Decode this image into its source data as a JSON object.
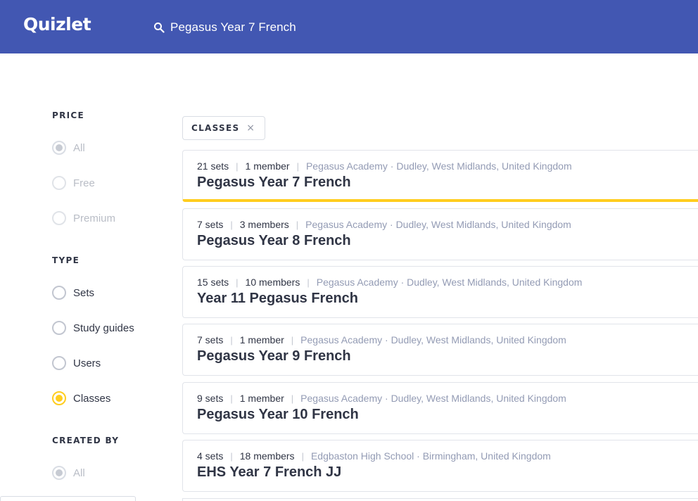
{
  "header": {
    "logo": "Quizlet",
    "search_icon": "search-icon",
    "search_query": "Pegasus Year 7 French"
  },
  "colors": {
    "header_bg": "#4257b2",
    "accent_yellow": "#ffcd1f",
    "text": "#303545",
    "muted": "#939bb4"
  },
  "filters": {
    "price": {
      "title": "PRICE",
      "options": [
        "All",
        "Free",
        "Premium"
      ],
      "selected": "All"
    },
    "type": {
      "title": "TYPE",
      "options": [
        "Sets",
        "Study guides",
        "Users",
        "Classes"
      ],
      "selected": "Classes"
    },
    "created_by": {
      "title": "CREATED BY",
      "options": [
        "All"
      ],
      "selected": "All"
    }
  },
  "active_filter_chip": {
    "label": "CLASSES",
    "close_icon": "close-icon",
    "close_glyph": "×"
  },
  "results": [
    {
      "sets": "21 sets",
      "members": "1 member",
      "school": "Pegasus Academy · Dudley, West Midlands, United Kingdom",
      "title": "Pegasus Year 7 French",
      "highlighted": true
    },
    {
      "sets": "7 sets",
      "members": "3 members",
      "school": "Pegasus Academy · Dudley, West Midlands, United Kingdom",
      "title": "Pegasus Year 8 French",
      "highlighted": false
    },
    {
      "sets": "15 sets",
      "members": "10 members",
      "school": "Pegasus Academy · Dudley, West Midlands, United Kingdom",
      "title": "Year 11 Pegasus French",
      "highlighted": false
    },
    {
      "sets": "7 sets",
      "members": "1 member",
      "school": "Pegasus Academy · Dudley, West Midlands, United Kingdom",
      "title": "Pegasus Year 9 French",
      "highlighted": false
    },
    {
      "sets": "9 sets",
      "members": "1 member",
      "school": "Pegasus Academy · Dudley, West Midlands, United Kingdom",
      "title": "Pegasus Year 10 French",
      "highlighted": false
    },
    {
      "sets": "4 sets",
      "members": "18 members",
      "school": "Edgbaston High School · Birmingham, United Kingdom",
      "title": "EHS Year 7 French JJ",
      "highlighted": false
    }
  ]
}
